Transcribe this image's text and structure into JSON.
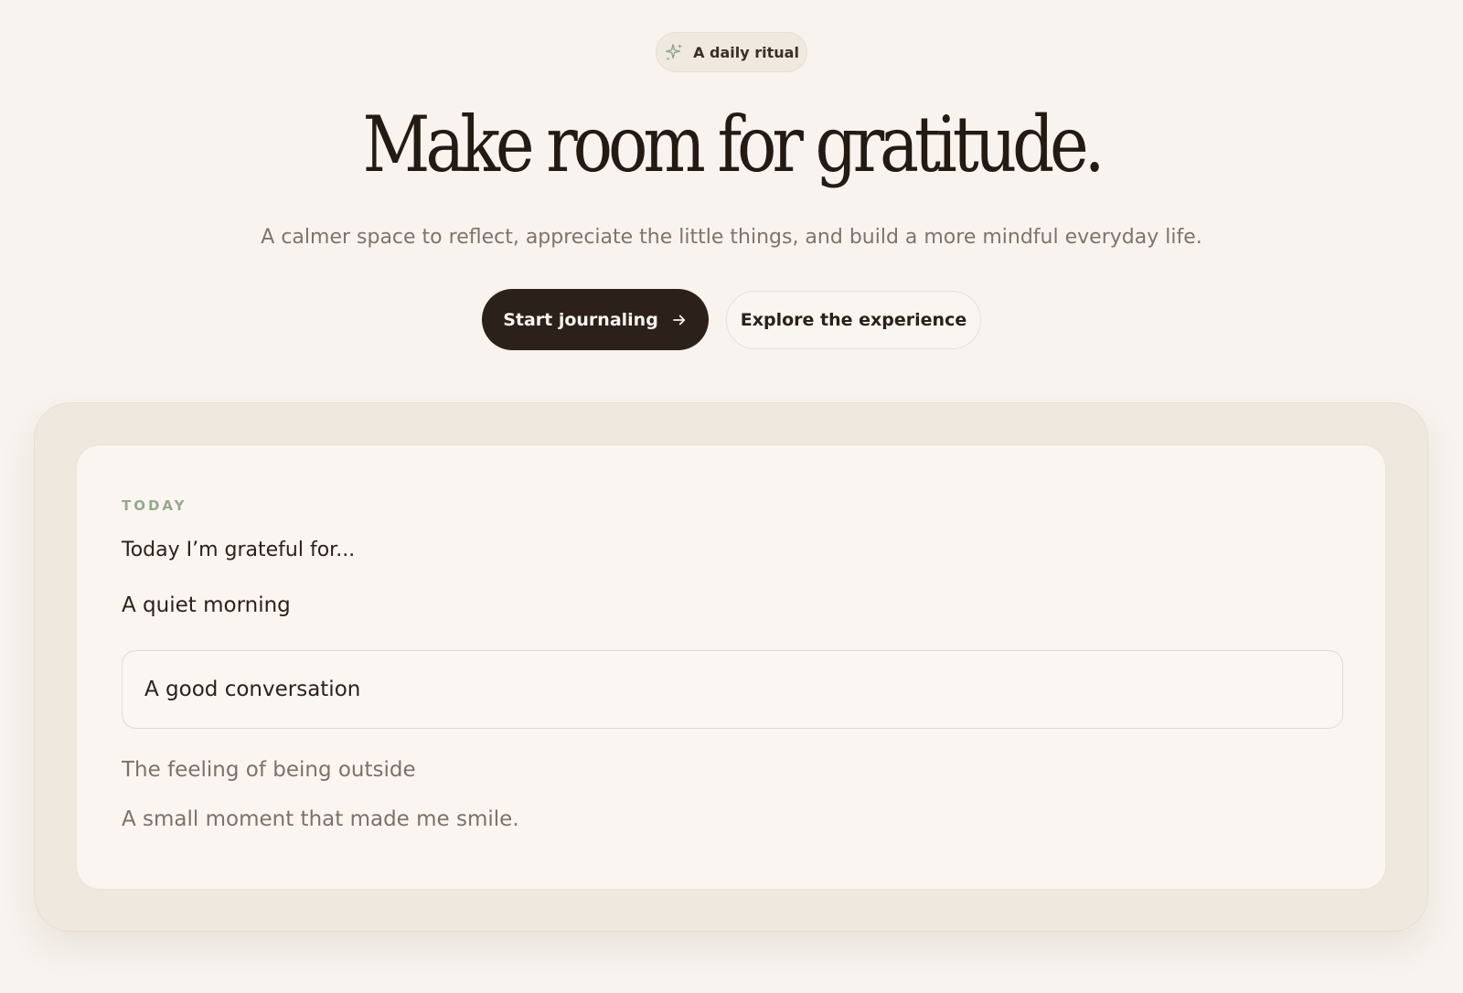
{
  "badge": {
    "icon": "sparkle-icon",
    "label": "A daily ritual"
  },
  "hero": {
    "title": "Make room for gratitude.",
    "subtitle": "A calmer space to reflect, appreciate the little things, and build a more mindful everyday life."
  },
  "actions": {
    "primary_label": "Start journaling",
    "primary_icon": "arrow-right-icon",
    "secondary_label": "Explore the experience"
  },
  "journal": {
    "day_label": "TODAY",
    "prompt": "Today I’m grateful for...",
    "entries": [
      "A quiet morning",
      "A good conversation",
      "The feeling of being outside",
      "A small moment that made me smile."
    ]
  },
  "colors": {
    "background": "#f8f3ee",
    "primary_button": "#2c211a",
    "accent_green": "#97a88f"
  }
}
